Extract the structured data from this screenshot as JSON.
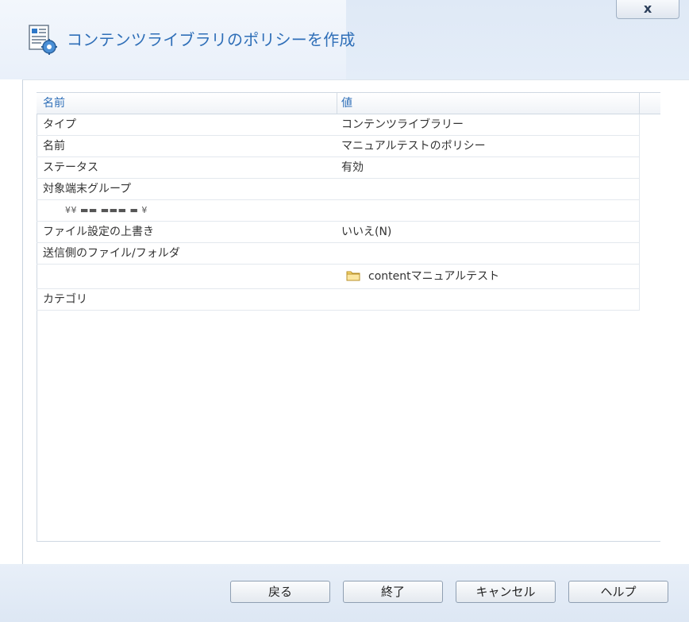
{
  "window": {
    "title": "コンテンツライブラリのポリシーを作成",
    "close_label": "x",
    "title_icon": "policy-settings-icon"
  },
  "grid": {
    "columns": [
      "名前",
      "値"
    ],
    "rows": [
      {
        "name": "タイプ",
        "value": "コンテンツライブラリー"
      },
      {
        "name": "名前",
        "value": "マニュアルテストのポリシー"
      },
      {
        "name": "ステータス",
        "value": "有効"
      },
      {
        "name": "対象端末グループ",
        "value": ""
      },
      {
        "name": "",
        "sub": "¥¥ ▬▬ ▬▬▬ ▬ ¥",
        "value": ""
      },
      {
        "name": "ファイル設定の上書き",
        "value": "いいえ(N)"
      },
      {
        "name": "送信側のファイル/フォルダ",
        "value": ""
      },
      {
        "name": "",
        "value": "contentマニュアルテスト",
        "icon": "folder-icon"
      },
      {
        "name": "カテゴリ",
        "value": ""
      }
    ]
  },
  "footer": {
    "back_label": "戻る",
    "finish_label": "終了",
    "cancel_label": "キャンセル",
    "help_label": "ヘルプ"
  },
  "colors": {
    "accent": "#2f6fb8",
    "header_bg": "#eef3fa",
    "footer_bg": "#e3ebf6"
  }
}
